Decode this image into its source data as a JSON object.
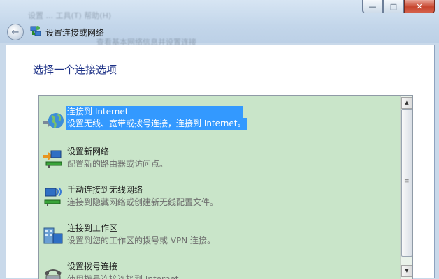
{
  "window": {
    "bg_text_1": "设置 ... 工具(T) 帮助(H)",
    "bg_text_2": "查看基本网络信息并设置连接",
    "nav_title": "设置连接或网络",
    "min_glyph": "—",
    "max_glyph": "□",
    "close_glyph": "✕",
    "back_glyph": "←"
  },
  "page": {
    "heading": "选择一个连接选项"
  },
  "options": [
    {
      "title": "连接到 Internet",
      "desc": "设置无线、宽带或拨号连接，连接到 Internet。",
      "icon": "globe-internet-icon",
      "selected": true
    },
    {
      "title": "设置新网络",
      "desc": "配置新的路由器或访问点。",
      "icon": "new-network-icon",
      "selected": false
    },
    {
      "title": "手动连接到无线网络",
      "desc": "连接到隐藏网络或创建新无线配置文件。",
      "icon": "wireless-network-icon",
      "selected": false
    },
    {
      "title": "连接到工作区",
      "desc": "设置到您的工作区的拨号或 VPN 连接。",
      "icon": "workplace-icon",
      "selected": false
    },
    {
      "title": "设置拨号连接",
      "desc": "使用拨号连接连接到 Internet。",
      "icon": "dialup-phone-icon",
      "selected": false
    }
  ],
  "scrollbar": {
    "up": "▲",
    "down": "▼",
    "grip": "≡"
  },
  "colors": {
    "list_bg": "#c9e5c9",
    "selection": "#3399ff",
    "heading": "#1e3287"
  }
}
